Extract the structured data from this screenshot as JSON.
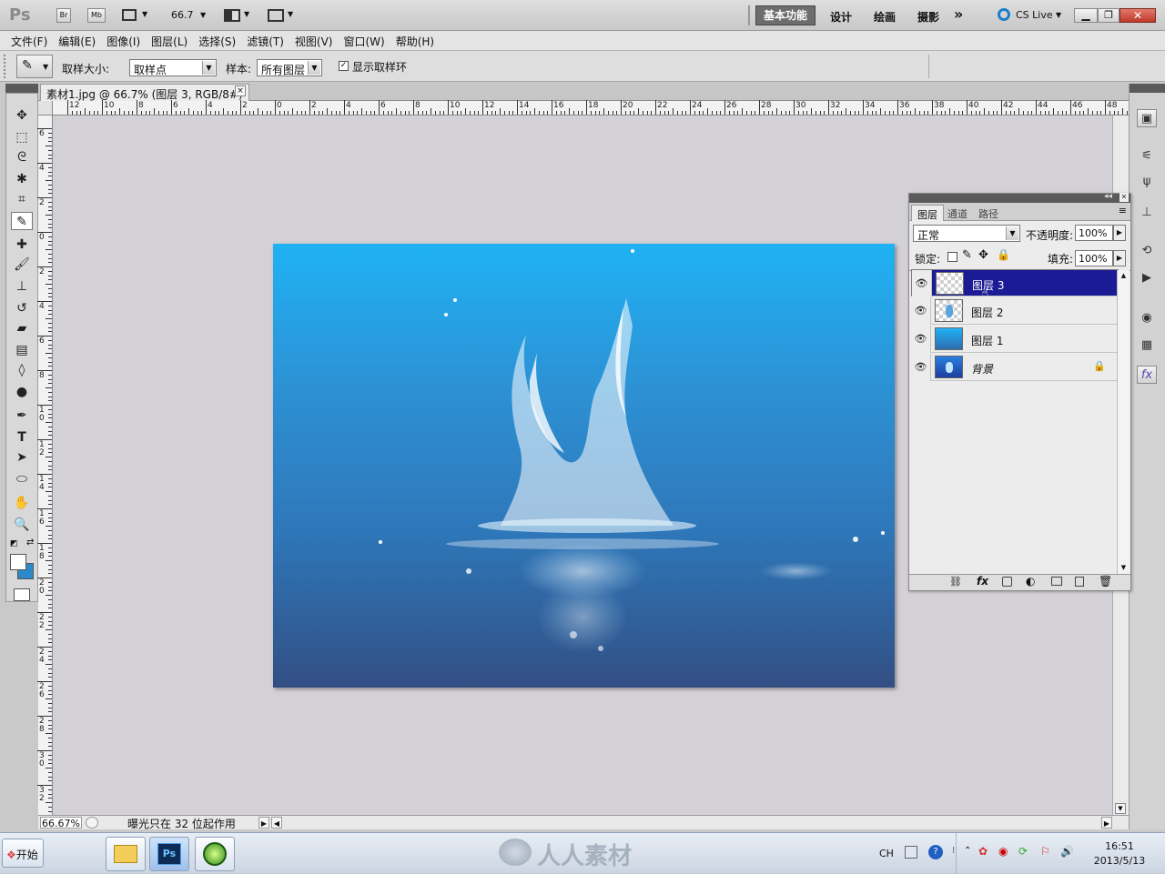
{
  "app": {
    "logo": "Ps",
    "bridge_label": "Br",
    "minibridge_label": "Mb",
    "zoom_value": "66.7",
    "workspaces": [
      "基本功能",
      "设计",
      "绘画",
      "摄影"
    ],
    "more_label": "»",
    "cslive_label": "CS Live"
  },
  "menu": [
    "文件(F)",
    "编辑(E)",
    "图像(I)",
    "图层(L)",
    "选择(S)",
    "滤镜(T)",
    "视图(V)",
    "窗口(W)",
    "帮助(H)"
  ],
  "options": {
    "sample_size_label": "取样大小:",
    "sample_size_value": "取样点",
    "sample_label": "样本:",
    "sample_value": "所有图层",
    "show_ring_label": "显示取样环",
    "show_ring_checked": true
  },
  "document": {
    "tab_title": "素材1.jpg @ 66.7% (图层 3, RGB/8#) *",
    "close_label": "×"
  },
  "ruler_h_labels": [
    "12",
    "10",
    "8",
    "6",
    "4",
    "2",
    "0",
    "2",
    "4",
    "6",
    "8",
    "10",
    "12",
    "14",
    "16",
    "18",
    "20",
    "22",
    "24",
    "26",
    "28",
    "30",
    "32",
    "34",
    "36",
    "38",
    "40",
    "42",
    "44",
    "46",
    "48"
  ],
  "ruler_v_labels": [
    "6",
    "4",
    "2",
    "0",
    "2",
    "4",
    "6",
    "8",
    "1 0",
    "1 2",
    "1 4",
    "1 6",
    "1 8",
    "2 0",
    "2 2",
    "2 4",
    "2 6",
    "2 8",
    "3 0",
    "3 2"
  ],
  "status": {
    "zoom": "66.67%",
    "message": "曝光只在 32 位起作用"
  },
  "layers_panel": {
    "tabs": [
      "图层",
      "通道",
      "路径"
    ],
    "blend_mode": "正常",
    "opacity_label": "不透明度:",
    "opacity_value": "100%",
    "lock_label": "锁定:",
    "fill_label": "填充:",
    "fill_value": "100%",
    "layers": [
      {
        "name": "图层 3",
        "selected": true
      },
      {
        "name": "图层 2",
        "selected": false
      },
      {
        "name": "图层 1",
        "selected": false
      },
      {
        "name": "背景",
        "selected": false,
        "locked": true
      }
    ]
  },
  "taskbar": {
    "start_label": "开始",
    "watermark": "人人素材",
    "lang": "CH",
    "time": "16:51",
    "date": "2013/5/13"
  },
  "colors": {
    "selected_layer": "#1b1b96",
    "image_top": "#1fb2f4",
    "image_bottom": "#324f84"
  }
}
